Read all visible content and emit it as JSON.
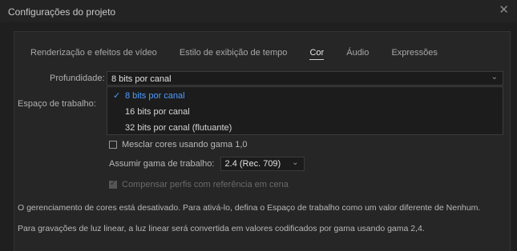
{
  "window": {
    "title": "Configurações do projeto",
    "close_icon": "close-icon"
  },
  "tabs": [
    {
      "label": "Renderização e efeitos de vídeo",
      "active": false
    },
    {
      "label": "Estilo de exibição de tempo",
      "active": false
    },
    {
      "label": "Cor",
      "active": true
    },
    {
      "label": "Áudio",
      "active": false
    },
    {
      "label": "Expressões",
      "active": false
    }
  ],
  "depth": {
    "label": "Profundidade:",
    "value": "8 bits por canal",
    "options": [
      "8 bits por canal",
      "16 bits por canal",
      "32 bits por canal (flutuante)"
    ],
    "selected_index": 0
  },
  "workspace": {
    "label": "Espaço de trabalho:"
  },
  "blend": {
    "label": "Mesclar cores usando gama 1,0",
    "checked": false
  },
  "gamma": {
    "label": "Assumir gama de trabalho:",
    "value": "2.4 (Rec. 709)"
  },
  "compensate": {
    "label": "Compensar perfis com referência em cena",
    "checked": true,
    "disabled": true
  },
  "info": {
    "line1": "O gerenciamento de cores está desativado. Para ativá-lo, defina o Espaço de trabalho como um valor diferente de Nenhum.",
    "line2": "Para gravações de luz linear, a luz linear será convertida em valores codificados por gama usando gama 2,4."
  },
  "colors": {
    "accent": "#4c9dff",
    "background": "#1f1f1f",
    "panel": "#262626"
  }
}
